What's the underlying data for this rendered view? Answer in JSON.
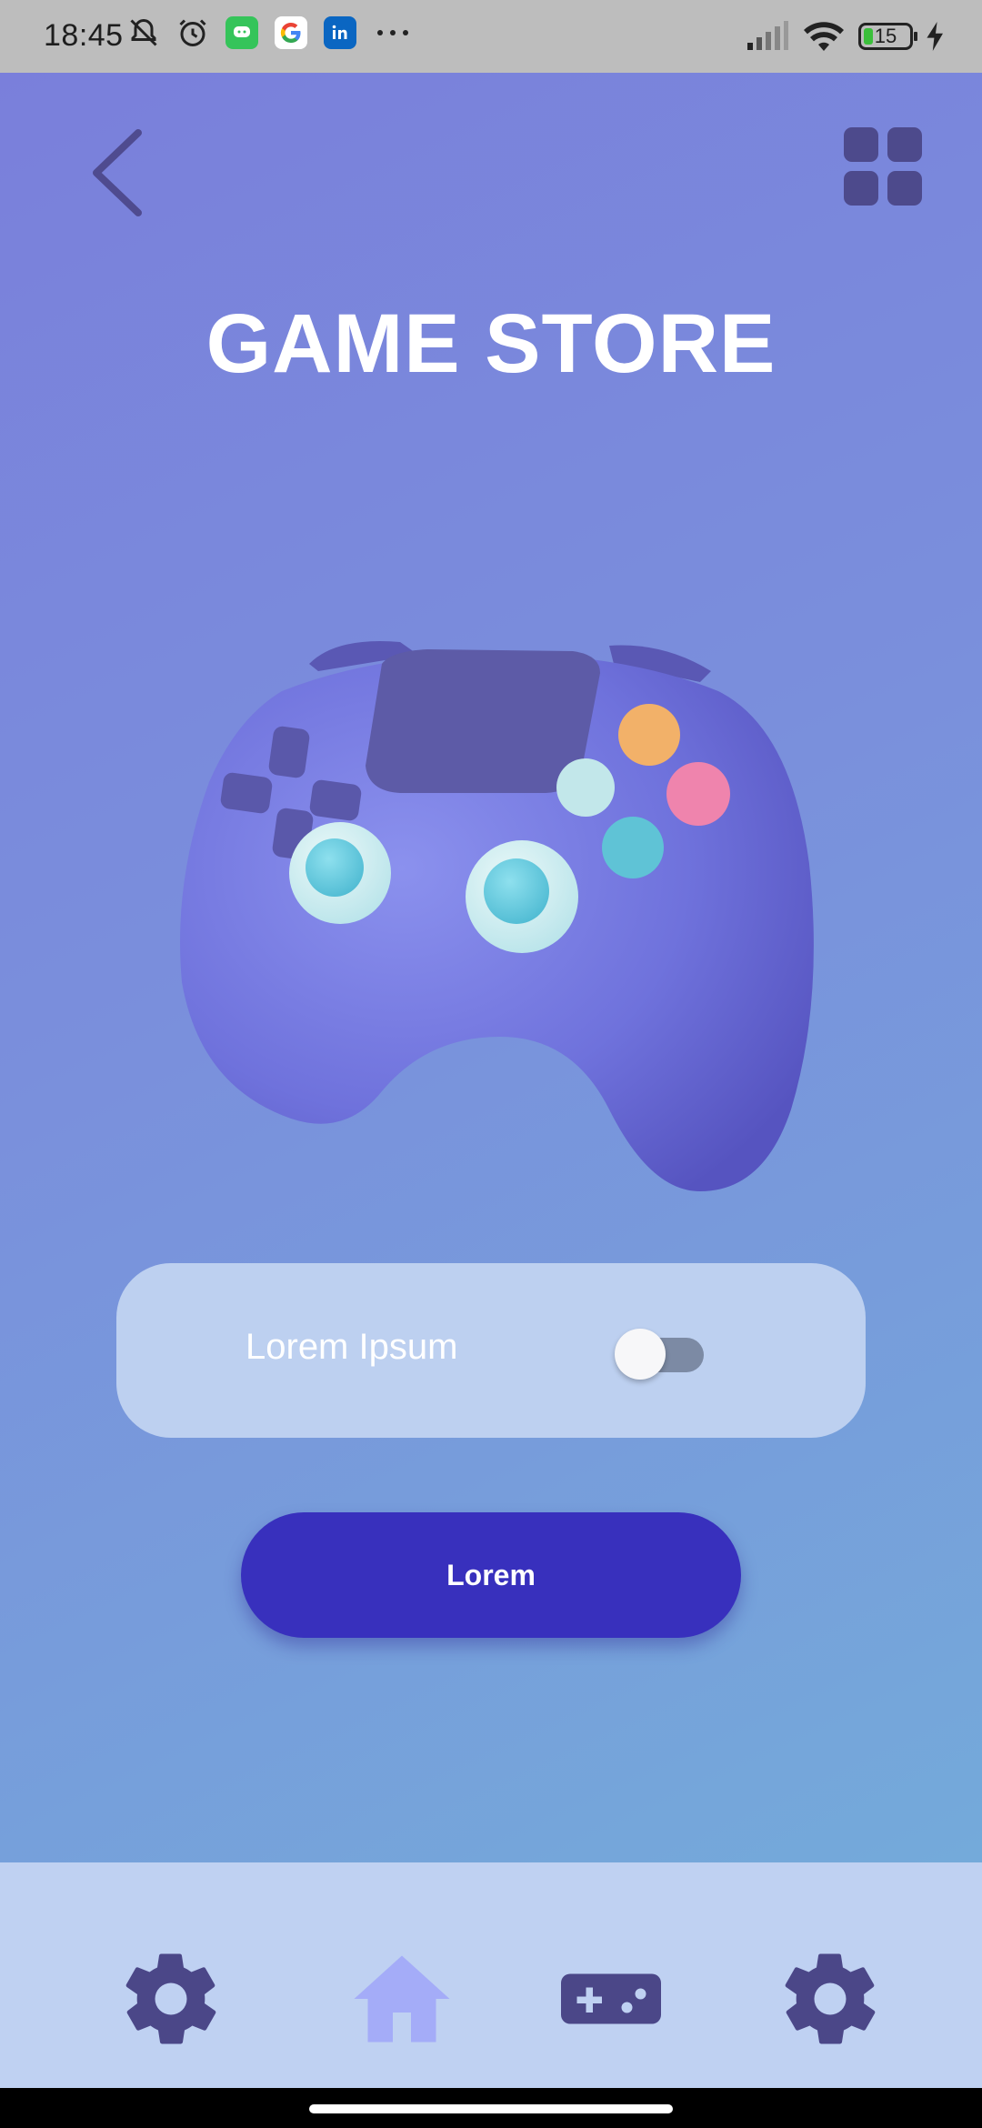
{
  "status_bar": {
    "time": "18:45",
    "icons_left": [
      "bell-off-icon",
      "alarm-icon",
      "messages-app-icon",
      "google-app-icon",
      "linkedin-app-icon",
      "more-icon"
    ],
    "battery_level": "15",
    "icons_right": [
      "signal-icon",
      "wifi-icon",
      "battery-icon",
      "charging-icon"
    ]
  },
  "header": {
    "back_icon": "chevron-left-icon",
    "menu_icon": "grid-icon",
    "title": "GAME STORE"
  },
  "hero": {
    "image": "gamepad-controller-illustration"
  },
  "toggle_card": {
    "label": "Lorem Ipsum",
    "switch_on": false
  },
  "primary_button": {
    "label": "Lorem"
  },
  "bottom_nav": {
    "items": [
      {
        "icon": "gear-icon",
        "active": false
      },
      {
        "icon": "home-icon",
        "active": true
      },
      {
        "icon": "gamepad-icon",
        "active": false
      },
      {
        "icon": "gear-icon",
        "active": false
      }
    ]
  },
  "colors": {
    "accent": "#3830bd",
    "icon_dark": "#4b4788",
    "nav_active": "#a4acf8",
    "card_bg": "#bdd0f0",
    "nav_bg": "#bfd1f2"
  }
}
